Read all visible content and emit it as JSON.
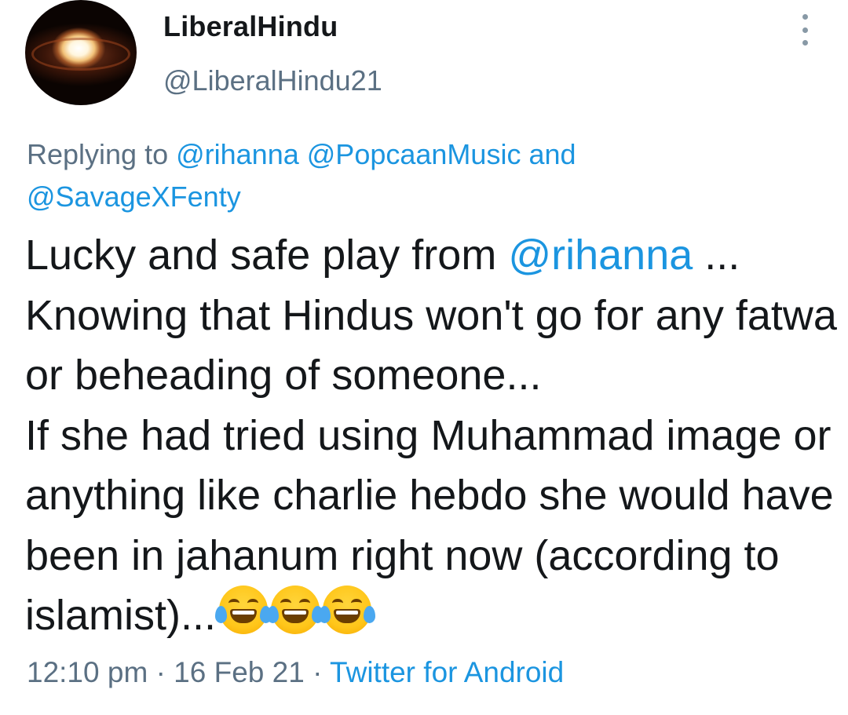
{
  "user": {
    "display_name": "LiberalHindu",
    "handle": "@LiberalHindu21"
  },
  "reply": {
    "prefix": "Replying to ",
    "mention_1": "@rihanna",
    "mention_2": "@PopcaanMusic",
    "conjunction": "and",
    "mention_3": "@SavageXFenty"
  },
  "tweet": {
    "part_1": "Lucky and safe play from ",
    "mention": "@rihanna",
    "part_2": " ...\nKnowing that Hindus won't go for any fatwa or beheading of someone...\nIf she had  tried using Muhammad image or anything like charlie hebdo she would have been in jahanum right now (according to islamist)...",
    "emoji": "face-with-tears-of-joy",
    "emoji_count": 3
  },
  "meta": {
    "time": "12:10 pm",
    "separator": "·",
    "date": "16 Feb 21",
    "source": "Twitter for Android"
  },
  "colors": {
    "text": "#14171a",
    "secondary": "#5b7083",
    "link": "#1b95e0"
  }
}
